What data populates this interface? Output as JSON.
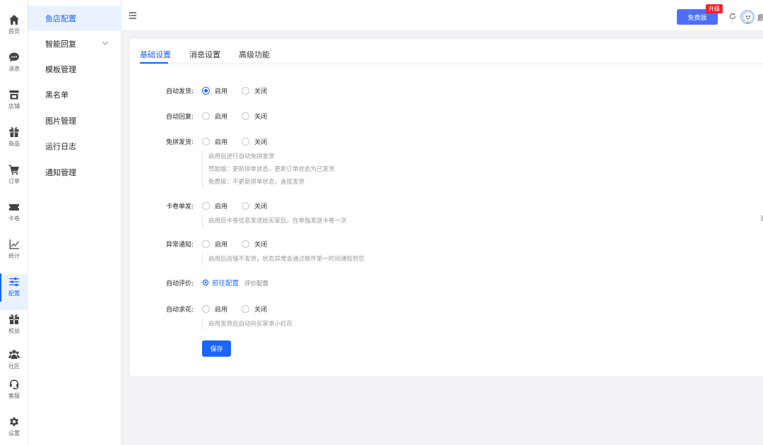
{
  "rail": [
    {
      "label": "首页",
      "icon": "home-icon"
    },
    {
      "label": "消息",
      "icon": "chat-icon"
    },
    {
      "label": "店铺",
      "icon": "store-icon"
    },
    {
      "label": "商品",
      "icon": "gift-box-icon"
    },
    {
      "label": "订单",
      "icon": "cart-icon"
    },
    {
      "label": "卡卷",
      "icon": "ticket-icon"
    },
    {
      "label": "统计",
      "icon": "line-chart-icon"
    },
    {
      "label": "配置",
      "icon": "sliders-icon"
    },
    {
      "label": "权益",
      "icon": "gift-icon"
    },
    {
      "label": "社区",
      "icon": "users-icon"
    },
    {
      "label": "客服",
      "icon": "headset-icon"
    },
    {
      "label": "设置",
      "icon": "gear-icon"
    }
  ],
  "subnav": [
    {
      "label": "鱼店配置"
    },
    {
      "label": "智能回复"
    },
    {
      "label": "模板管理"
    },
    {
      "label": "黑名单"
    },
    {
      "label": "图片管理"
    },
    {
      "label": "运行日志"
    },
    {
      "label": "通知管理"
    }
  ],
  "topbar": {
    "free_label": "免费版",
    "upgrade_label": "升级",
    "username": "鼎"
  },
  "tabs": [
    {
      "label": "基础设置"
    },
    {
      "label": "消息设置"
    },
    {
      "label": "高级功能"
    }
  ],
  "form": {
    "on_label": "启用",
    "off_label": "关闭",
    "rows": {
      "auto_ship": {
        "label": "自动发货:"
      },
      "auto_reply": {
        "label": "自动回复:"
      },
      "free_group": {
        "label": "免拼发货:",
        "hints": [
          "启用后进行自动免拼发货",
          "赞助版：更新拼单状态，更新订单状态为已发货",
          "免费版：不更新拼单状态，直接发货"
        ]
      },
      "card_single": {
        "label": "卡卷单发:",
        "hint": "启用后卡卷信息发送给买家后，在单独发送卡卷一次"
      },
      "abnormal": {
        "label": "异常通知:",
        "hint": "启用后店铺不发货，状态异常会通过邮件第一时间通知到您"
      },
      "auto_review": {
        "label": "自动评价:",
        "link": "前往配置",
        "note": "评价配置"
      },
      "auto_flower": {
        "label": "自动求花:",
        "hint": "启用发货后自动向买家求小红花"
      }
    },
    "save_label": "保存"
  },
  "colors": {
    "primary": "#1a66ff",
    "badge": "#f5222d",
    "free_btn": "#4f6ef7"
  }
}
